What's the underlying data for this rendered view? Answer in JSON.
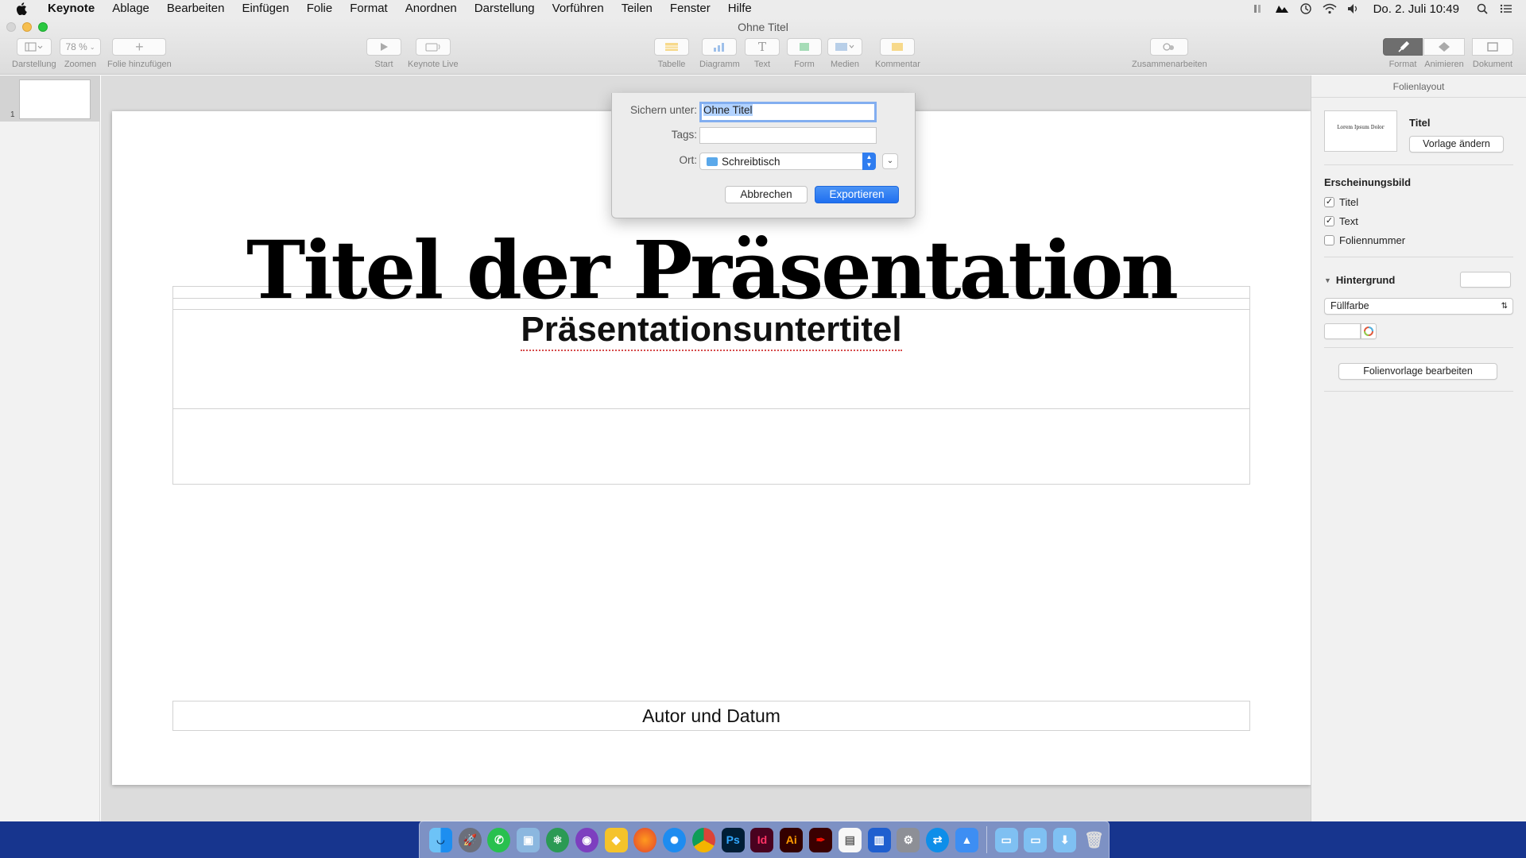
{
  "menubar": {
    "app_name": "Keynote",
    "items": [
      "Ablage",
      "Bearbeiten",
      "Einfügen",
      "Folie",
      "Format",
      "Anordnen",
      "Darstellung",
      "Vorführen",
      "Teilen",
      "Fenster",
      "Hilfe"
    ],
    "clock": "Do. 2. Juli  10:49"
  },
  "window": {
    "title": "Ohne Titel"
  },
  "toolbar": {
    "darstellung": "Darstellung",
    "zoom_value": "78 %",
    "zoomen": "Zoomen",
    "folie_hinzufuegen": "Folie hinzufügen",
    "start": "Start",
    "keynote_live": "Keynote Live",
    "tabelle": "Tabelle",
    "diagramm": "Diagramm",
    "text": "Text",
    "form": "Form",
    "medien": "Medien",
    "kommentar": "Kommentar",
    "zusammenarbeiten": "Zusammenarbeiten",
    "format": "Format",
    "animieren": "Animieren",
    "dokument": "Dokument"
  },
  "navigator": {
    "slide_number": "1"
  },
  "slide": {
    "title": "Titel der Präsentation",
    "subtitle": "Präsentationsuntertitel",
    "author": "Autor und Datum"
  },
  "inspector": {
    "header": "Folienlayout",
    "thumb_text": "Lorem Ipsum Dolor",
    "layout_name": "Titel",
    "change_master": "Vorlage ändern",
    "appearance_heading": "Erscheinungsbild",
    "options": [
      {
        "label": "Titel",
        "checked": true
      },
      {
        "label": "Text",
        "checked": true
      },
      {
        "label": "Foliennummer",
        "checked": false
      }
    ],
    "background_heading": "Hintergrund",
    "fill_type": "Füllfarbe",
    "edit_master": "Folienvorlage bearbeiten"
  },
  "dialog": {
    "save_as_label": "Sichern unter:",
    "save_as_value": "Ohne Titel",
    "tags_label": "Tags:",
    "tags_value": "",
    "location_label": "Ort:",
    "location_value": "Schreibtisch",
    "cancel": "Abbrechen",
    "export": "Exportieren"
  },
  "dock": {
    "apps": [
      "finder",
      "launchpad",
      "whatsapp",
      "preview",
      "atom",
      "github",
      "cyberduck",
      "firefox",
      "safari",
      "chrome",
      "Ps",
      "Id",
      "Ai",
      "acrobat",
      "textedit",
      "keynote-doc",
      "preferences",
      "teamviewer",
      "keynote"
    ],
    "accent_colors": {
      "Ps": "#001e36",
      "Id": "#49021f",
      "Ai": "#330000"
    }
  },
  "colors": {
    "accent": "#2f7df0",
    "dialog_focus": "#82aef0",
    "desktop": "#17358e"
  }
}
